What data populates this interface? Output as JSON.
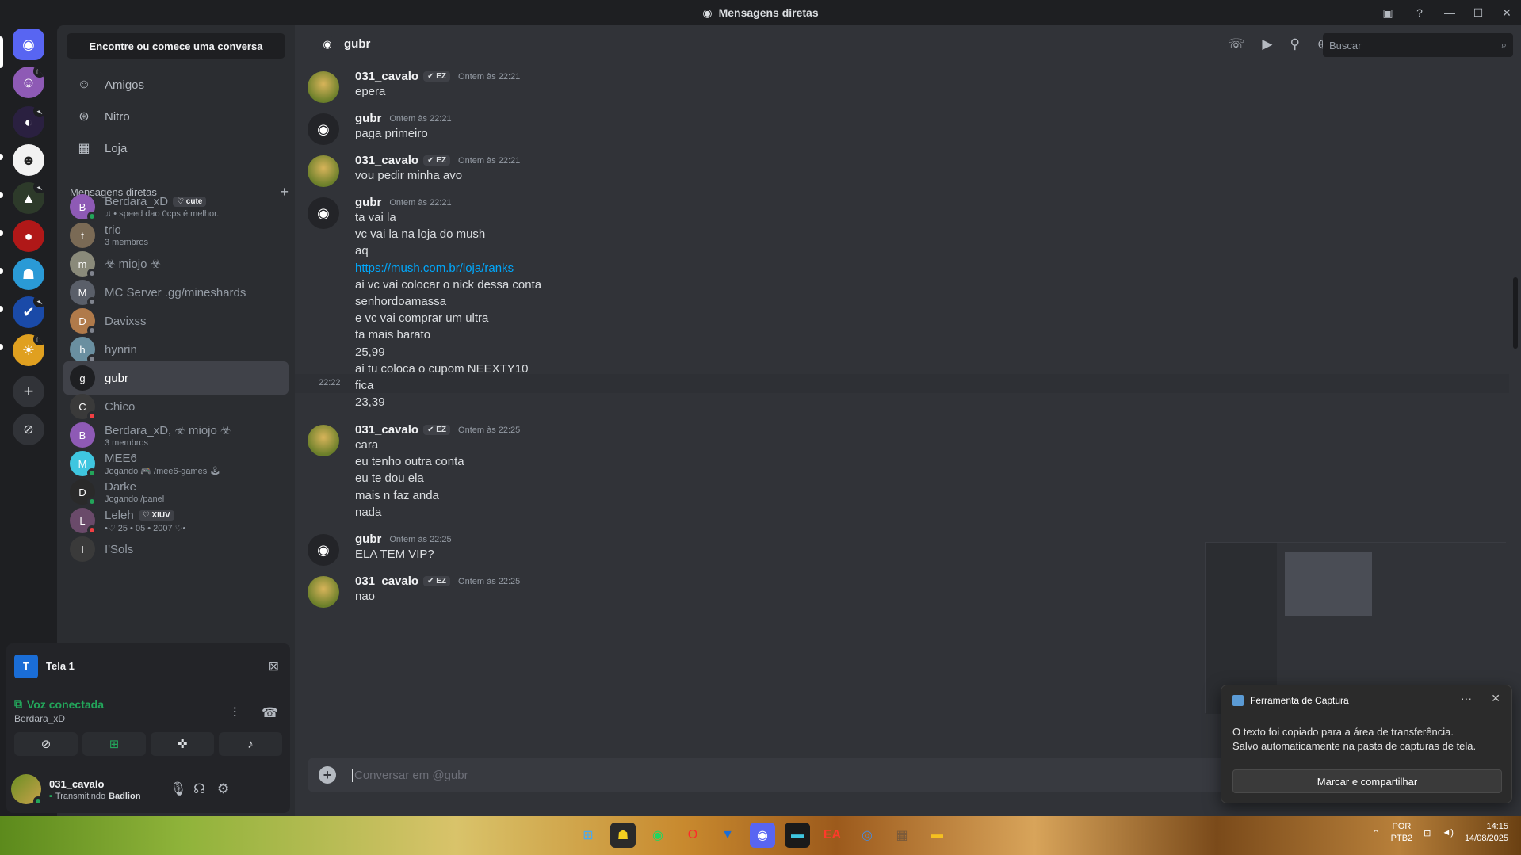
{
  "window": {
    "title": "Mensagens diretas"
  },
  "sidebar": {
    "search_button": "Encontre ou comece uma conversa",
    "nav": [
      {
        "label": "Amigos",
        "icon": "friends-icon"
      },
      {
        "label": "Nitro",
        "icon": "nitro-icon"
      },
      {
        "label": "Loja",
        "icon": "shop-icon"
      }
    ],
    "dm_section_title": "Mensagens diretas",
    "dms": [
      {
        "name": "Berdara_xD",
        "badge": "♡ cute",
        "sub": "♫ • speed dao 0cps é melhor.",
        "status": "on",
        "color": "#8e5ab5"
      },
      {
        "name": "trio",
        "badge": "",
        "sub": "3 membros",
        "status": "",
        "color": "#7a6a55"
      },
      {
        "name": "☣ miojo ☣",
        "badge": "",
        "sub": "",
        "status": "off",
        "color": "#8a8a7a"
      },
      {
        "name": "MC Server .gg/mineshards",
        "badge": "",
        "sub": "",
        "status": "off",
        "color": "#5a5f69"
      },
      {
        "name": "Davixss",
        "badge": "",
        "sub": "",
        "status": "off",
        "color": "#b07a4a"
      },
      {
        "name": "hynrin",
        "badge": "",
        "sub": "",
        "status": "off",
        "color": "#6a8fa0"
      },
      {
        "name": "gubr",
        "badge": "",
        "sub": "",
        "status": "",
        "color": "#1e1f22"
      },
      {
        "name": "Chico",
        "badge": "",
        "sub": "",
        "status": "dnd",
        "color": "#3a3a3a"
      },
      {
        "name": "Berdara_xD, ☣ miojo ☣",
        "badge": "",
        "sub": "3 membros",
        "status": "",
        "color": "#8e5ab5"
      },
      {
        "name": "MEE6",
        "badge": "",
        "sub": "Jogando 🎮 /mee6-games 🕹",
        "status": "on",
        "color": "#3fc6e0"
      },
      {
        "name": "Darke",
        "badge": "",
        "sub": "Jogando /panel",
        "status": "on",
        "color": "#2a2a2a"
      },
      {
        "name": "Leleh",
        "badge": "♡ XIUV",
        "sub": "•♡ 25 • 05 • 2007 ♡•",
        "status": "dnd",
        "color": "#6a4a6a"
      },
      {
        "name": "I'Sols",
        "badge": "",
        "sub": "",
        "status": "",
        "color": "#3a3a3a"
      }
    ]
  },
  "voice": {
    "screen_label": "Tela 1",
    "screen_thumb": "T",
    "status": "Voz conectada",
    "channel": "Berdara_xD"
  },
  "user": {
    "name": "031_cavalo",
    "activity_prefix": "Transmitindo",
    "activity": "Badlion"
  },
  "chat": {
    "recipient": "gubr",
    "search_placeholder": "Buscar",
    "composer_placeholder": "Conversar em @gubr",
    "hover_time": "22:22",
    "groups": [
      {
        "author": "031_cavalo",
        "tag": "✔ EZ",
        "time": "Ontem às 22:21",
        "lines": [
          "epera"
        ]
      },
      {
        "author": "gubr",
        "tag": "",
        "time": "Ontem às 22:21",
        "lines": [
          "paga primeiro"
        ]
      },
      {
        "author": "031_cavalo",
        "tag": "✔ EZ",
        "time": "Ontem às 22:21",
        "lines": [
          "vou pedir minha avo"
        ]
      },
      {
        "author": "gubr",
        "tag": "",
        "time": "Ontem às 22:21",
        "lines": [
          "ta vai la",
          "vc vai la na loja do mush",
          "aq",
          "https://mush.com.br/loja/ranks",
          "ai vc vai colocar o nick dessa conta",
          "senhordoamassa",
          "e vc vai comprar um ultra",
          "ta mais barato",
          "25,99",
          "ai tu coloca o cupom NEEXTY10",
          "fica",
          "23,39"
        ]
      },
      {
        "author": "031_cavalo",
        "tag": "✔ EZ",
        "time": "Ontem às 22:25",
        "lines": [
          "cara",
          "eu tenho outra conta",
          "eu te dou ela",
          "mais n faz anda",
          "nada"
        ]
      },
      {
        "author": "gubr",
        "tag": "",
        "time": "Ontem às 22:25",
        "lines": [
          "ELA TEM VIP?"
        ]
      },
      {
        "author": "031_cavalo",
        "tag": "✔ EZ",
        "time": "Ontem às 22:25",
        "lines": [
          "nao"
        ]
      }
    ]
  },
  "snip": {
    "app": "Ferramenta de Captura",
    "line1": "O texto foi copiado para a área de transferência.",
    "line2": "Salvo automaticamente na pasta de capturas de tela.",
    "button": "Marcar e compartilhar"
  },
  "taskbar": {
    "lang1": "POR",
    "lang2": "PTB2",
    "time": "14:15",
    "date": "14/08/2025"
  }
}
